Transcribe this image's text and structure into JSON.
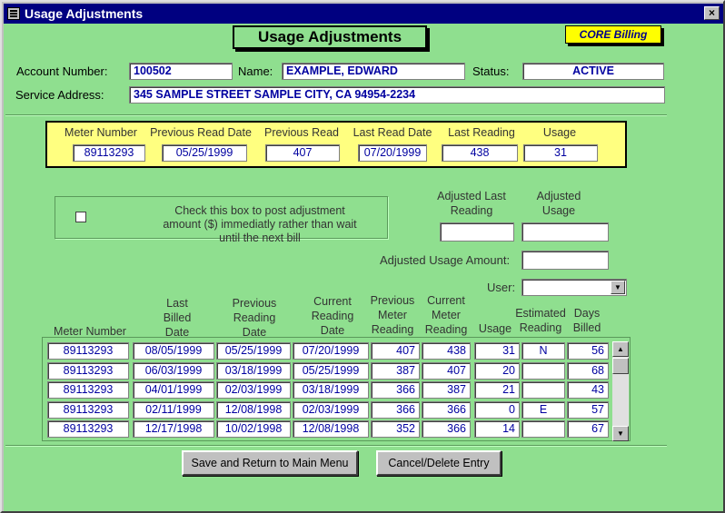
{
  "window": {
    "title": "Usage Adjustments",
    "close_glyph": "×"
  },
  "header": {
    "title": "Usage Adjustments",
    "badge": "CORE Billing"
  },
  "account": {
    "account_number_label": "Account Number:",
    "account_number": "100502",
    "name_label": "Name:",
    "name": "EXAMPLE, EDWARD",
    "status_label": "Status:",
    "status": "ACTIVE",
    "service_address_label": "Service Address:",
    "service_address": "345 SAMPLE STREET SAMPLE CITY, CA  94954-2234"
  },
  "meter": {
    "headers": [
      "Meter Number",
      "Previous Read Date",
      "Previous Read",
      "Last Read Date",
      "Last Reading",
      "Usage"
    ],
    "values": [
      "89113293",
      "05/25/1999",
      "407",
      "07/20/1999",
      "438",
      "31"
    ]
  },
  "post_option": {
    "checked": false,
    "label": "Check this box to post adjustment amount ($) immediatly rather than wait until the next bill"
  },
  "adjust": {
    "adjusted_last_reading_label": "Adjusted Last Reading",
    "adjusted_usage_label": "Adjusted Usage",
    "adjusted_last_reading": "",
    "adjusted_usage": "",
    "adjusted_usage_amount_label": "Adjusted Usage Amount:",
    "adjusted_usage_amount": "",
    "user_label": "User:",
    "user": ""
  },
  "history": {
    "headers": {
      "meter_number": "Meter Number",
      "last_billed_date": "Last Billed Date",
      "previous_reading_date": "Previous Reading Date",
      "current_reading_date": "Current Reading Date",
      "previous_meter_reading": "Previous Meter Reading",
      "current_meter_reading": "Current Meter Reading",
      "usage": "Usage",
      "estimated_reading": "Estimated Reading",
      "days_billed": "Days Billed"
    },
    "rows": [
      [
        "89113293",
        "08/05/1999",
        "05/25/1999",
        "07/20/1999",
        "407",
        "438",
        "31",
        "N",
        "56"
      ],
      [
        "89113293",
        "06/03/1999",
        "03/18/1999",
        "05/25/1999",
        "387",
        "407",
        "20",
        "",
        "68"
      ],
      [
        "89113293",
        "04/01/1999",
        "02/03/1999",
        "03/18/1999",
        "366",
        "387",
        "21",
        "",
        "43"
      ],
      [
        "89113293",
        "02/11/1999",
        "12/08/1998",
        "02/03/1999",
        "366",
        "366",
        "0",
        "E",
        "57"
      ],
      [
        "89113293",
        "12/17/1998",
        "10/02/1998",
        "12/08/1998",
        "352",
        "366",
        "14",
        "",
        "67"
      ]
    ]
  },
  "buttons": {
    "save": "Save and Return to Main Menu",
    "cancel": "Cancel/Delete Entry"
  },
  "icons": {
    "scroll_up": "▲",
    "scroll_down": "▼",
    "dropdown": "▼"
  }
}
